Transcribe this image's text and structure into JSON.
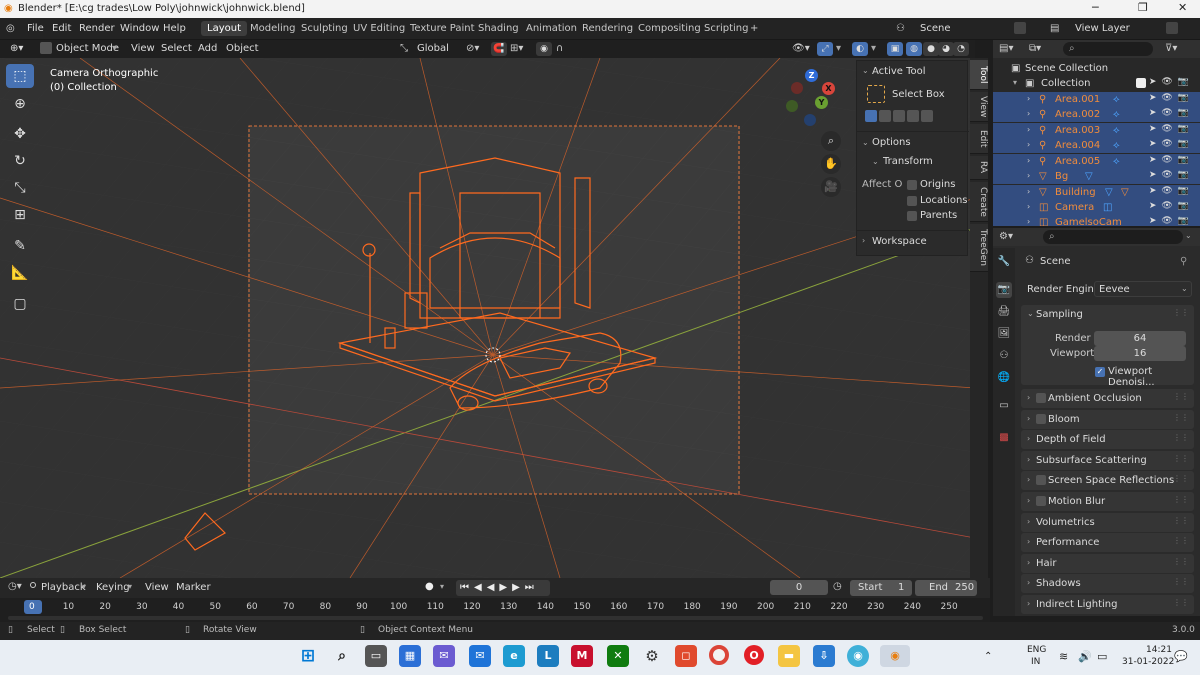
{
  "window": {
    "title": "Blender* [E:\\cg trades\\Low Poly\\johnwick\\johnwick.blend]",
    "controls": [
      "─",
      "❐",
      "✕"
    ]
  },
  "menubar": {
    "items": [
      "File",
      "Edit",
      "Render",
      "Window",
      "Help"
    ],
    "workspaces": [
      "Layout",
      "Modeling",
      "Sculpting",
      "UV Editing",
      "Texture Paint",
      "Shading",
      "Animation",
      "Rendering",
      "Compositing",
      "Scripting"
    ],
    "active_workspace": "Layout",
    "add_tab": "+",
    "scene": "Scene",
    "view_layer": "View Layer"
  },
  "viewport_header": {
    "mode": "Object Mode",
    "view": "View",
    "select": "Select",
    "add": "Add",
    "object": "Object",
    "orientation": "Global"
  },
  "viewport": {
    "view_name": "Camera Orthographic",
    "collection": "(0) Collection",
    "gizmo": {
      "x": "X",
      "y": "Y",
      "z": "Z"
    }
  },
  "npanel": {
    "active_tool_title": "Active Tool",
    "tool_name": "Select Box",
    "options_title": "Options",
    "transform_title": "Transform",
    "affect_label": "Affect O",
    "affect_options": [
      "Origins",
      "Locations",
      "Parents"
    ],
    "workspace_title": "Workspace",
    "tabs": [
      "Tool",
      "View",
      "Edit",
      "RA",
      "Create",
      "TreeGen"
    ]
  },
  "outliner": {
    "root": "Scene Collection",
    "collection": "Collection",
    "items": [
      "Area.001",
      "Area.002",
      "Area.003",
      "Area.004",
      "Area.005",
      "Bg",
      "Building",
      "Camera",
      "GamelsoCam"
    ]
  },
  "properties": {
    "scene_label": "Scene",
    "render_engine_label": "Render Engine",
    "render_engine": "Eevee",
    "sampling": {
      "title": "Sampling",
      "render_label": "Render",
      "render_value": "64",
      "viewport_label": "Viewport",
      "viewport_value": "16",
      "denoise_label": "Viewport Denoisi..."
    },
    "panels": [
      {
        "label": "Ambient Occlusion",
        "checkbox": true
      },
      {
        "label": "Bloom",
        "checkbox": true
      },
      {
        "label": "Depth of Field",
        "checkbox": false
      },
      {
        "label": "Subsurface Scattering",
        "checkbox": false
      },
      {
        "label": "Screen Space Reflections",
        "checkbox": true
      },
      {
        "label": "Motion Blur",
        "checkbox": true
      },
      {
        "label": "Volumetrics",
        "checkbox": false
      },
      {
        "label": "Performance",
        "checkbox": false
      },
      {
        "label": "Hair",
        "checkbox": false
      },
      {
        "label": "Shadows",
        "checkbox": false
      },
      {
        "label": "Indirect Lighting",
        "checkbox": false
      }
    ]
  },
  "timeline": {
    "playback": "Playback",
    "keying": "Keying",
    "view": "View",
    "marker": "Marker",
    "current_frame": "0",
    "start_label": "Start",
    "start": "1",
    "end_label": "End",
    "end": "250",
    "ticks": [
      "0",
      "10",
      "20",
      "30",
      "40",
      "50",
      "60",
      "70",
      "80",
      "90",
      "100",
      "110",
      "120",
      "130",
      "140",
      "150",
      "160",
      "170",
      "180",
      "190",
      "200",
      "210",
      "220",
      "230",
      "240",
      "250"
    ]
  },
  "statusbar": {
    "select": "Select",
    "box_select": "Box Select",
    "rotate_view": "Rotate View",
    "context_menu": "Object Context Menu",
    "version": "3.0.0"
  },
  "taskbar": {
    "lang": "ENG",
    "region": "IN",
    "time": "14:21",
    "date": "31-01-2022"
  }
}
